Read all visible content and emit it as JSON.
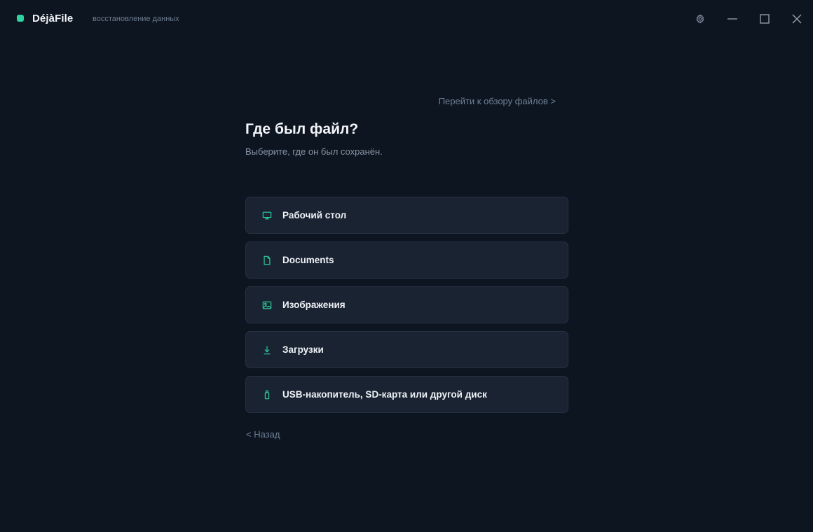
{
  "app": {
    "name": "DéjàFile",
    "subtitle": "восстановление данных",
    "accent_color": "#2dd4a0"
  },
  "window_controls": {
    "settings_icon": "gear-icon",
    "minimize_icon": "minimize-icon",
    "maximize_icon": "maximize-icon",
    "close_icon": "close-icon"
  },
  "main": {
    "browse_link": "Перейти к обзору файлов >",
    "title": "Где был файл?",
    "subtitle": "Выберите, где он был сохранён.",
    "options": [
      {
        "label": "Рабочий стол",
        "icon": "monitor-icon"
      },
      {
        "label": "Documents",
        "icon": "document-icon"
      },
      {
        "label": "Изображения",
        "icon": "image-icon"
      },
      {
        "label": "Загрузки",
        "icon": "download-icon"
      },
      {
        "label": "USB-накопитель, SD-карта или другой диск",
        "icon": "usb-drive-icon"
      }
    ],
    "back_link": "< Назад"
  }
}
